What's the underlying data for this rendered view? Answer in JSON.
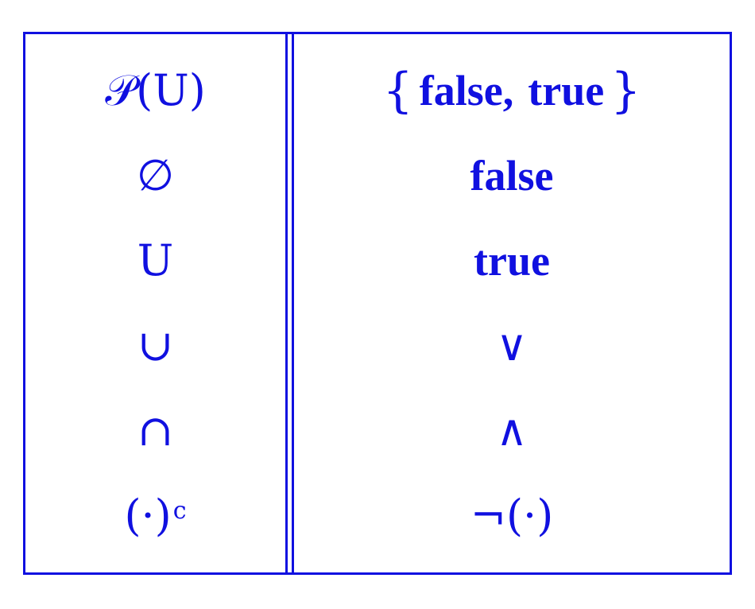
{
  "table": {
    "left_column": [
      {
        "text": "𝒫(U)"
      },
      {
        "text": "∅"
      },
      {
        "text": "U"
      },
      {
        "text": "∪"
      },
      {
        "text": "∩"
      },
      {
        "base": "(·)",
        "sup": "c"
      }
    ],
    "right_column": [
      {
        "open": "{",
        "a": "false",
        "comma": ",",
        "b": "true",
        "close": "}"
      },
      {
        "text": "false"
      },
      {
        "text": "true"
      },
      {
        "text": "∨"
      },
      {
        "text": "∧"
      },
      {
        "text": "¬(·)"
      }
    ]
  },
  "colors": {
    "ink": "#1010e0",
    "background": "#ffffff"
  }
}
